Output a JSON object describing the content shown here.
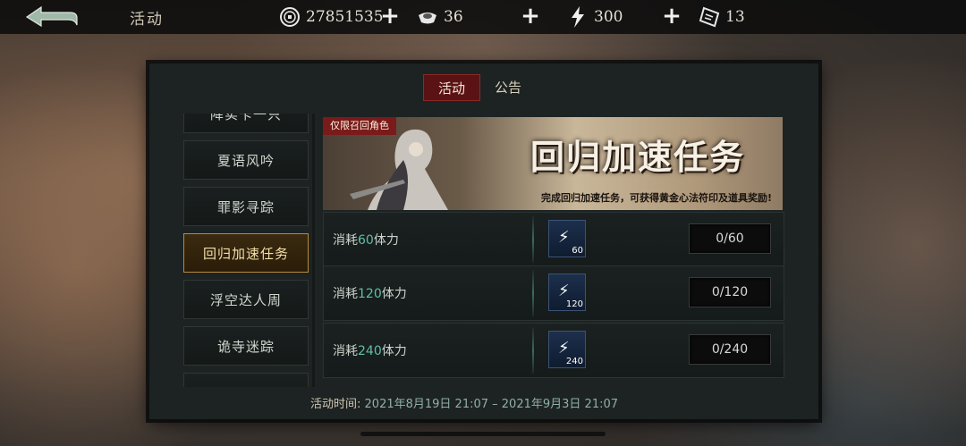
{
  "header": {
    "title": "活动",
    "resources": [
      {
        "icon": "coin-icon",
        "value": "27851535"
      },
      {
        "icon": "ingot-icon",
        "value": "36"
      },
      {
        "icon": "stamina-bolt-icon",
        "value": "300"
      },
      {
        "icon": "ticket-icon",
        "value": "13"
      }
    ]
  },
  "tabs": [
    {
      "label": "活动",
      "active": true
    },
    {
      "label": "公告",
      "active": false
    }
  ],
  "sidebar": {
    "items": [
      {
        "label": "降实卡一只",
        "active": false
      },
      {
        "label": "夏语风吟",
        "active": false
      },
      {
        "label": "罪影寻踪",
        "active": false
      },
      {
        "label": "回归加速任务",
        "active": true
      },
      {
        "label": "浮空达人周",
        "active": false
      },
      {
        "label": "诡寺迷踪",
        "active": false
      },
      {
        "label": "",
        "active": false
      }
    ]
  },
  "banner": {
    "tag": "仅限召回角色",
    "title": "回归加速任务",
    "subtitle": "完成回归加速任务，可获得黄金心法符印及道具奖励!"
  },
  "tasks": [
    {
      "prefix": "消耗",
      "amount": "60",
      "suffix": "体力",
      "reward_count": "60",
      "progress": "0/60"
    },
    {
      "prefix": "消耗",
      "amount": "120",
      "suffix": "体力",
      "reward_count": "120",
      "progress": "0/120"
    },
    {
      "prefix": "消耗",
      "amount": "240",
      "suffix": "体力",
      "reward_count": "240",
      "progress": "0/240"
    }
  ],
  "footer": {
    "time_label": "活动时间:",
    "time_value": "2021年8月19日 21:07 – 2021年9月3日 21:07"
  }
}
